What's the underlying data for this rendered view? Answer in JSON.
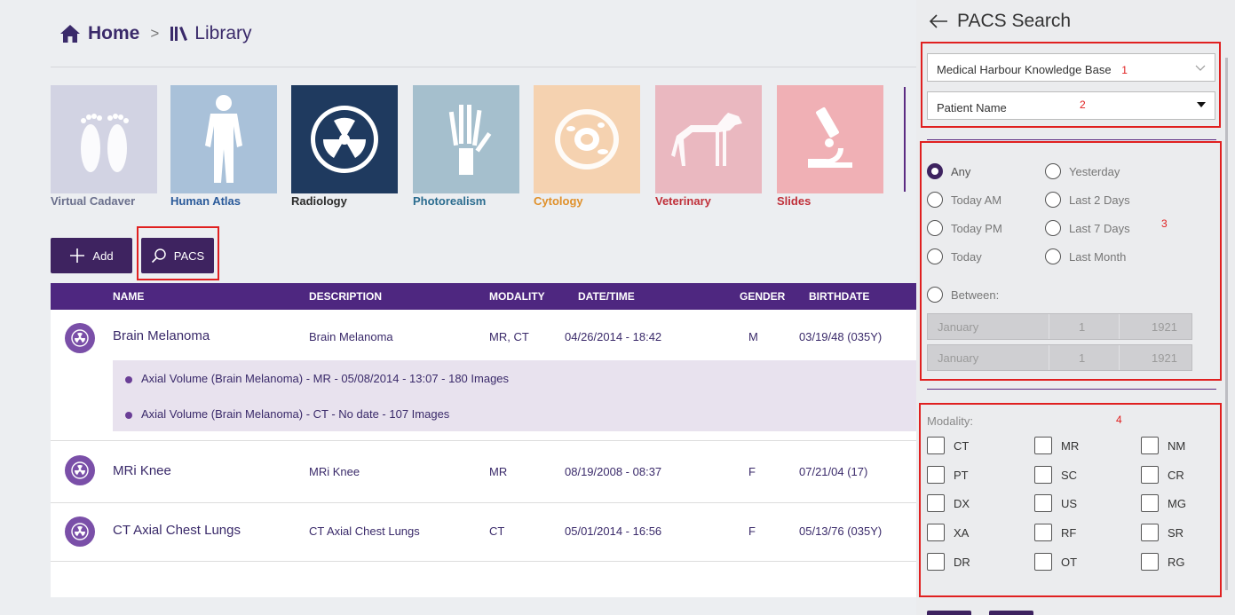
{
  "breadcrumb": {
    "home": "Home",
    "separator": ">",
    "library": "Library"
  },
  "tiles": [
    {
      "label": "Virtual Cadaver",
      "bg": "#d2d3e3",
      "label_color": "#6a6f8c"
    },
    {
      "label": "Human Atlas",
      "bg": "#a9c1d9",
      "label_color": "#2a5a9a"
    },
    {
      "label": "Radiology",
      "bg": "#1f3a5f",
      "label_color": "#2b2b2b"
    },
    {
      "label": "Photorealism",
      "bg": "#a5bfcd",
      "label_color": "#2b6c8f"
    },
    {
      "label": "Cytology",
      "bg": "#f5d2b0",
      "label_color": "#e0902a"
    },
    {
      "label": "Veterinary",
      "bg": "#eab8c0",
      "label_color": "#c0303a"
    },
    {
      "label": "Slides",
      "bg": "#f0b0b5",
      "label_color": "#c0303a"
    }
  ],
  "toolbar": {
    "add_label": "Add",
    "pacs_label": "PACS"
  },
  "table": {
    "headers": [
      "NAME",
      "DESCRIPTION",
      "MODALITY",
      "DATE/TIME",
      "GENDER",
      "BIRTHDATE"
    ],
    "rows": [
      {
        "name": "Brain Melanoma",
        "description": "Brain Melanoma",
        "modality": "MR, CT",
        "datetime": "04/26/2014 - 18:42",
        "gender": "M",
        "birthdate": "03/19/48 (035Y)",
        "series": [
          "Axial Volume (Brain Melanoma)  -  MR  -  05/08/2014 - 13:07  -  180 Images",
          "Axial Volume (Brain Melanoma)  -  CT  -  No date  -  107 Images"
        ]
      },
      {
        "name": "MRi Knee",
        "description": "MRi Knee",
        "modality": "MR",
        "datetime": "08/19/2008 - 08:37",
        "gender": "F",
        "birthdate": "07/21/04 (17)"
      },
      {
        "name": "CT Axial Chest Lungs",
        "description": "CT Axial Chest Lungs",
        "modality": "CT",
        "datetime": "05/01/2014 - 16:56",
        "gender": "F",
        "birthdate": "05/13/76 (035Y)"
      }
    ]
  },
  "panel": {
    "title": "PACS Search",
    "source_select": {
      "value": "Medical Harbour Knowledge Base",
      "marker": "1"
    },
    "field_select": {
      "value": "Patient Name",
      "marker": "2"
    },
    "date_marker": "3",
    "date_options": [
      {
        "label": "Any",
        "selected": true
      },
      {
        "label": "Yesterday",
        "selected": false
      },
      {
        "label": "Today AM",
        "selected": false
      },
      {
        "label": "Last 2 Days",
        "selected": false
      },
      {
        "label": "Today PM",
        "selected": false
      },
      {
        "label": "Last 7 Days",
        "selected": false
      },
      {
        "label": "Today",
        "selected": false
      },
      {
        "label": "Last Month",
        "selected": false
      },
      {
        "label": "Between:",
        "selected": false
      }
    ],
    "between_from": {
      "month": "January",
      "day": "1",
      "year": "1921"
    },
    "between_to": {
      "month": "January",
      "day": "1",
      "year": "1921"
    },
    "modality_label": "Modality:",
    "modality_marker": "4",
    "modalities": [
      "CT",
      "MR",
      "NM",
      "PT",
      "SC",
      "CR",
      "DX",
      "US",
      "MG",
      "XA",
      "RF",
      "SR",
      "DR",
      "OT",
      "RG"
    ]
  }
}
